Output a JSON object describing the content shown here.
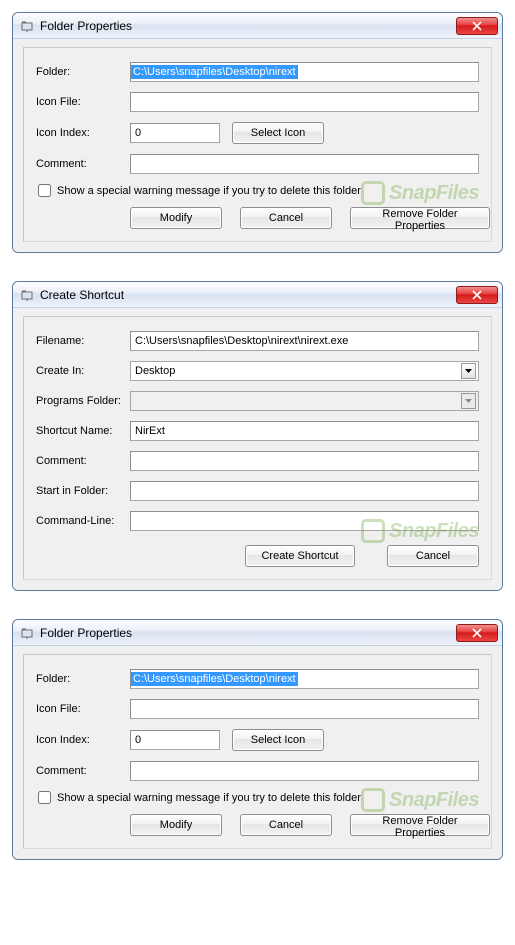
{
  "dialogs": {
    "folderProps": {
      "title": "Folder Properties",
      "label_folder": "Folder:",
      "value_folder": "C:\\Users\\snapfiles\\Desktop\\nirext",
      "label_iconfile": "Icon File:",
      "value_iconfile": "",
      "label_iconindex": "Icon Index:",
      "value_iconindex": "0",
      "btn_selecticon": "Select Icon",
      "label_comment": "Comment:",
      "value_comment": "",
      "check_warning": "Show a special warning message if you try to delete this folder",
      "btn_modify": "Modify",
      "btn_cancel": "Cancel",
      "btn_remove": "Remove Folder Properties"
    },
    "createShortcut": {
      "title": "Create Shortcut",
      "label_filename": "Filename:",
      "value_filename": "C:\\Users\\snapfiles\\Desktop\\nirext\\nirext.exe",
      "label_createin": "Create In:",
      "value_createin": "Desktop",
      "label_programsfolder": "Programs Folder:",
      "value_programsfolder": "",
      "label_shortcutname": "Shortcut Name:",
      "value_shortcutname": "NirExt",
      "label_comment": "Comment:",
      "value_comment": "",
      "label_startin": "Start in Folder:",
      "value_startin": "",
      "label_cmdline": "Command-Line:",
      "value_cmdline": "",
      "btn_create": "Create Shortcut",
      "btn_cancel": "Cancel"
    }
  },
  "watermark": "SnapFiles"
}
